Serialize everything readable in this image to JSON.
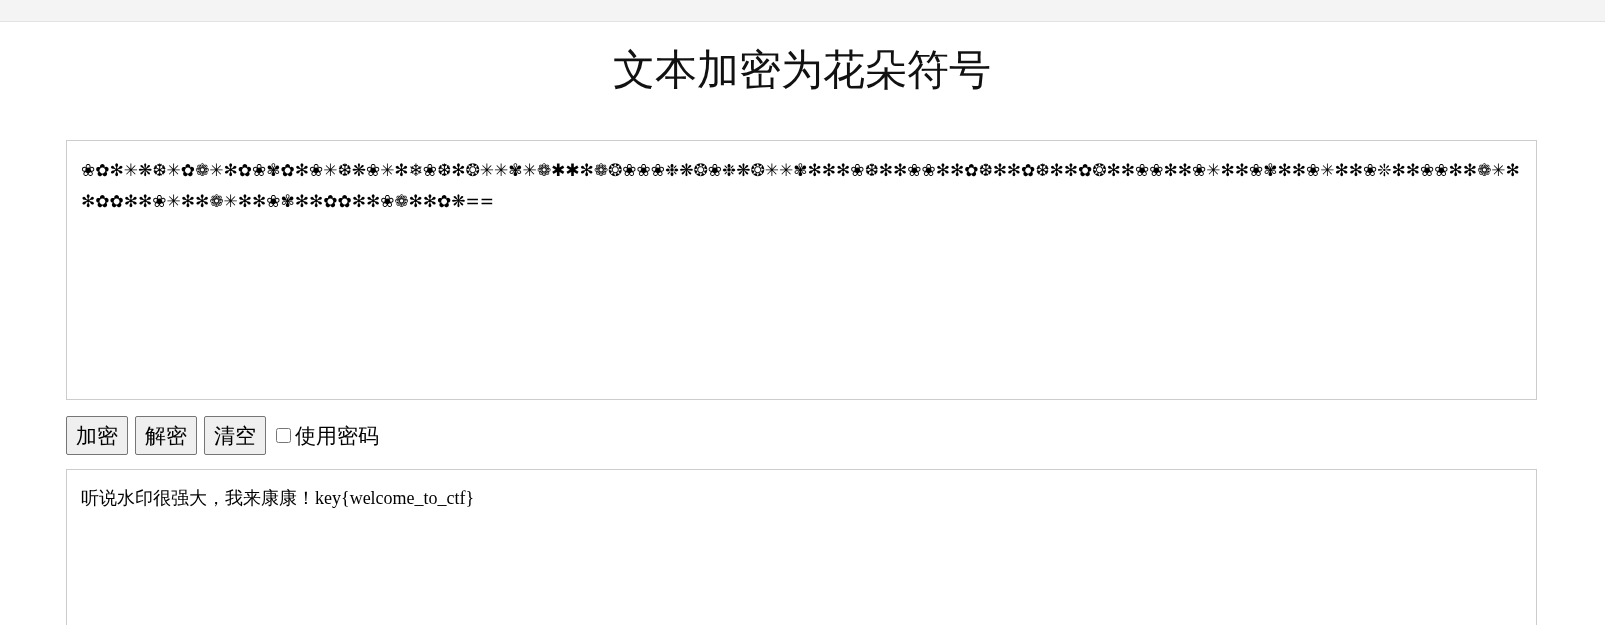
{
  "title": "文本加密为花朵符号",
  "input": {
    "value": "❀✿✻✳❋❆✳✿❁✳✻✿❀✾✿✻❀✳❆❋❀✳✻❄❀❆✻❂✳✳✾✳❁✱✱✻❁❂❀❀❀❉❋❂❀❉❋❂✳✳✾✻✻✻❀❆✻✻❀❀✻✻✿❆✻✻✿❆✻✻✿❂✻✻❀❀✻✻❀✳✻✻❀✾✻✻❀✳✻✻❀❊✻✻❀❀✻✻❁✳✻✻✿✿✻✻❀✳✻✻❁✳✻✻❀✾✻✻✿✿✻✻❀❁✻✻✿❋=="
  },
  "buttons": [
    {
      "label": "加密"
    },
    {
      "label": "解密"
    },
    {
      "label": "清空"
    }
  ],
  "use_password": {
    "label": "使用密码",
    "checked": false
  },
  "output": {
    "value": "听说水印很强大，我来康康！key{welcome_to_ctf}"
  }
}
